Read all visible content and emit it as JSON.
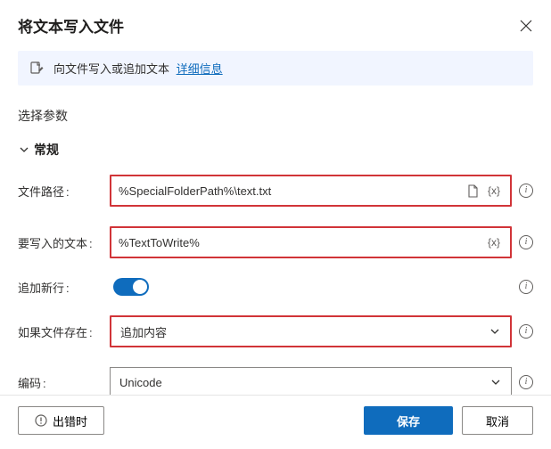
{
  "header": {
    "title": "将文本写入文件"
  },
  "info": {
    "text": "向文件写入或追加文本",
    "link": "详细信息"
  },
  "section_label": "选择参数",
  "group_label": "常规",
  "fields": {
    "file_path": {
      "label": "文件路径",
      "value": "%SpecialFolderPath%\\text.txt"
    },
    "text_to_write": {
      "label": "要写入的文本",
      "value": "%TextToWrite%"
    },
    "append_newline": {
      "label": "追加新行",
      "on": true
    },
    "if_exists": {
      "label": "如果文件存在",
      "value": "追加内容"
    },
    "encoding": {
      "label": "编码",
      "value": "Unicode"
    }
  },
  "footer": {
    "on_error": "出错时",
    "save": "保存",
    "cancel": "取消"
  }
}
